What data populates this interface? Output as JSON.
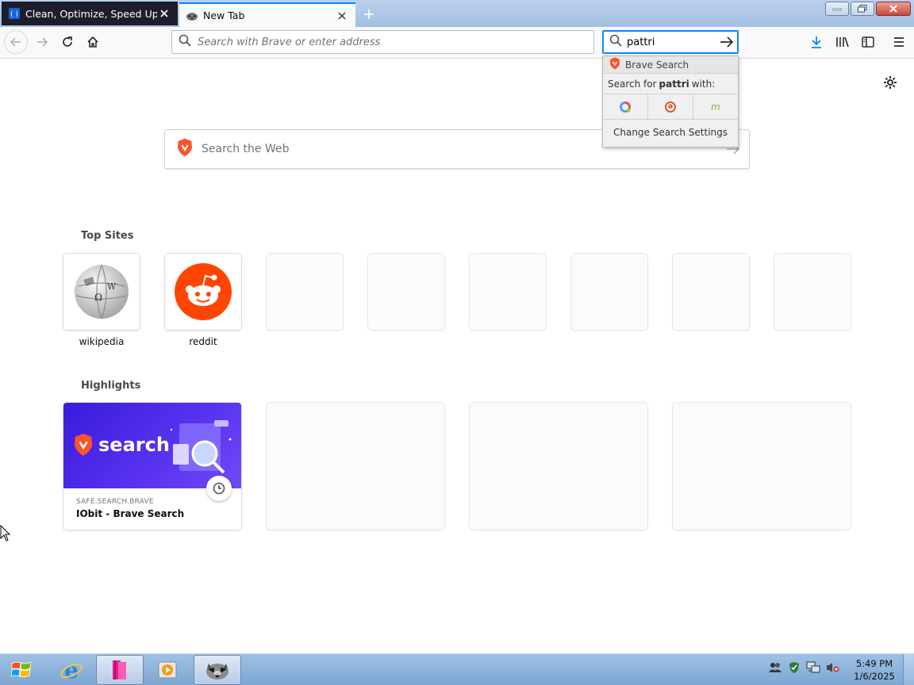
{
  "tabs": [
    {
      "title": "Clean, Optimize, Speed Up and",
      "active": false,
      "favicon": "iobit-icon"
    },
    {
      "title": "New Tab",
      "active": true,
      "favicon": "raccoon-icon"
    }
  ],
  "navbar": {
    "url_placeholder": "Search with Brave or enter address",
    "search_value": "pattri"
  },
  "search_popup": {
    "engine_header": "Brave Search",
    "search_for_prefix": "Search for",
    "search_for_term": "pattri",
    "search_for_suffix": "with:",
    "engines": [
      "qwant-icon",
      "duckduckgo-icon",
      "mojeek-icon"
    ],
    "settings_label": "Change Search Settings"
  },
  "page": {
    "websearch_placeholder": "Search the Web",
    "top_sites_title": "Top Sites",
    "top_sites": [
      {
        "label": "wikipedia",
        "icon": "wikipedia-globe-icon"
      },
      {
        "label": "reddit",
        "icon": "reddit-icon"
      },
      {
        "label": ""
      },
      {
        "label": ""
      },
      {
        "label": ""
      },
      {
        "label": ""
      },
      {
        "label": ""
      },
      {
        "label": ""
      }
    ],
    "highlights_title": "Highlights",
    "highlights": [
      {
        "host": "SAFE.SEARCH.BRAVE",
        "title": "IObit - Brave Search",
        "image_text": "search"
      }
    ]
  },
  "taskbar": {
    "time": "5:49 PM",
    "date": "1/6/2025"
  },
  "colors": {
    "accent": "#0a84ff",
    "brave_orange": "#fb542b",
    "reddit_orange": "#ff4500",
    "highlight_purple": "#4a25e6"
  }
}
